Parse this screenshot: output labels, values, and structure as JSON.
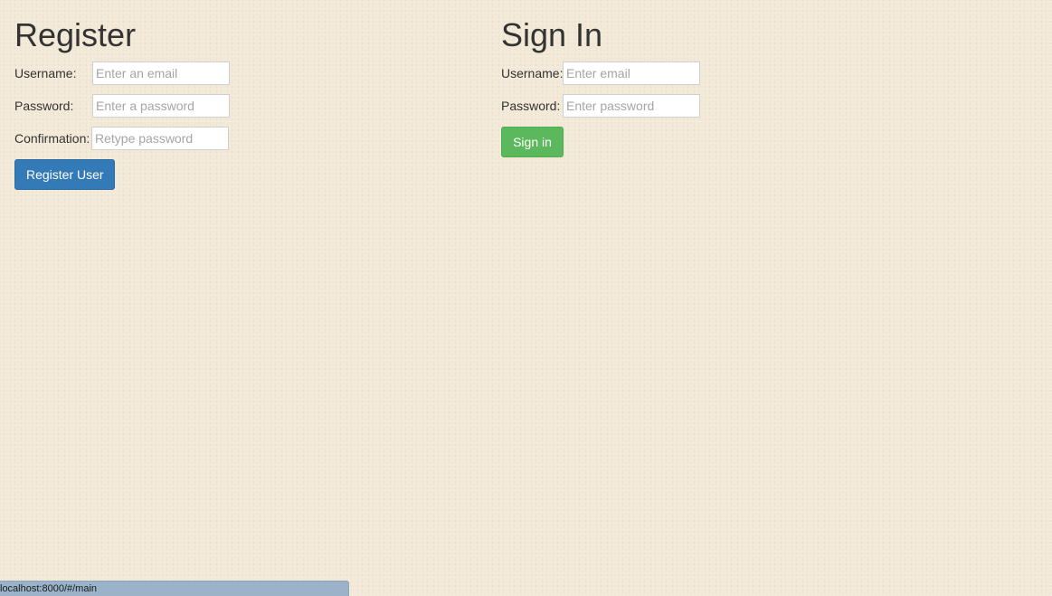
{
  "register": {
    "title": "Register",
    "username_label": "Username:",
    "username_placeholder": "Enter an email",
    "password_label": "Password:",
    "password_placeholder": "Enter a password",
    "confirmation_label": "Confirmation:",
    "confirmation_placeholder": "Retype password",
    "submit_label": "Register User"
  },
  "signin": {
    "title": "Sign In",
    "username_label": "Username:",
    "username_placeholder": "Enter email",
    "password_label": "Password:",
    "password_placeholder": "Enter password",
    "submit_label": "Sign in"
  },
  "status_bar": {
    "url": "localhost:8000/#/main"
  },
  "colors": {
    "background": "#f1e8d6",
    "primary_button": "#337ab7",
    "success_button": "#5cb85c",
    "status_bar": "#9ab3c9"
  }
}
